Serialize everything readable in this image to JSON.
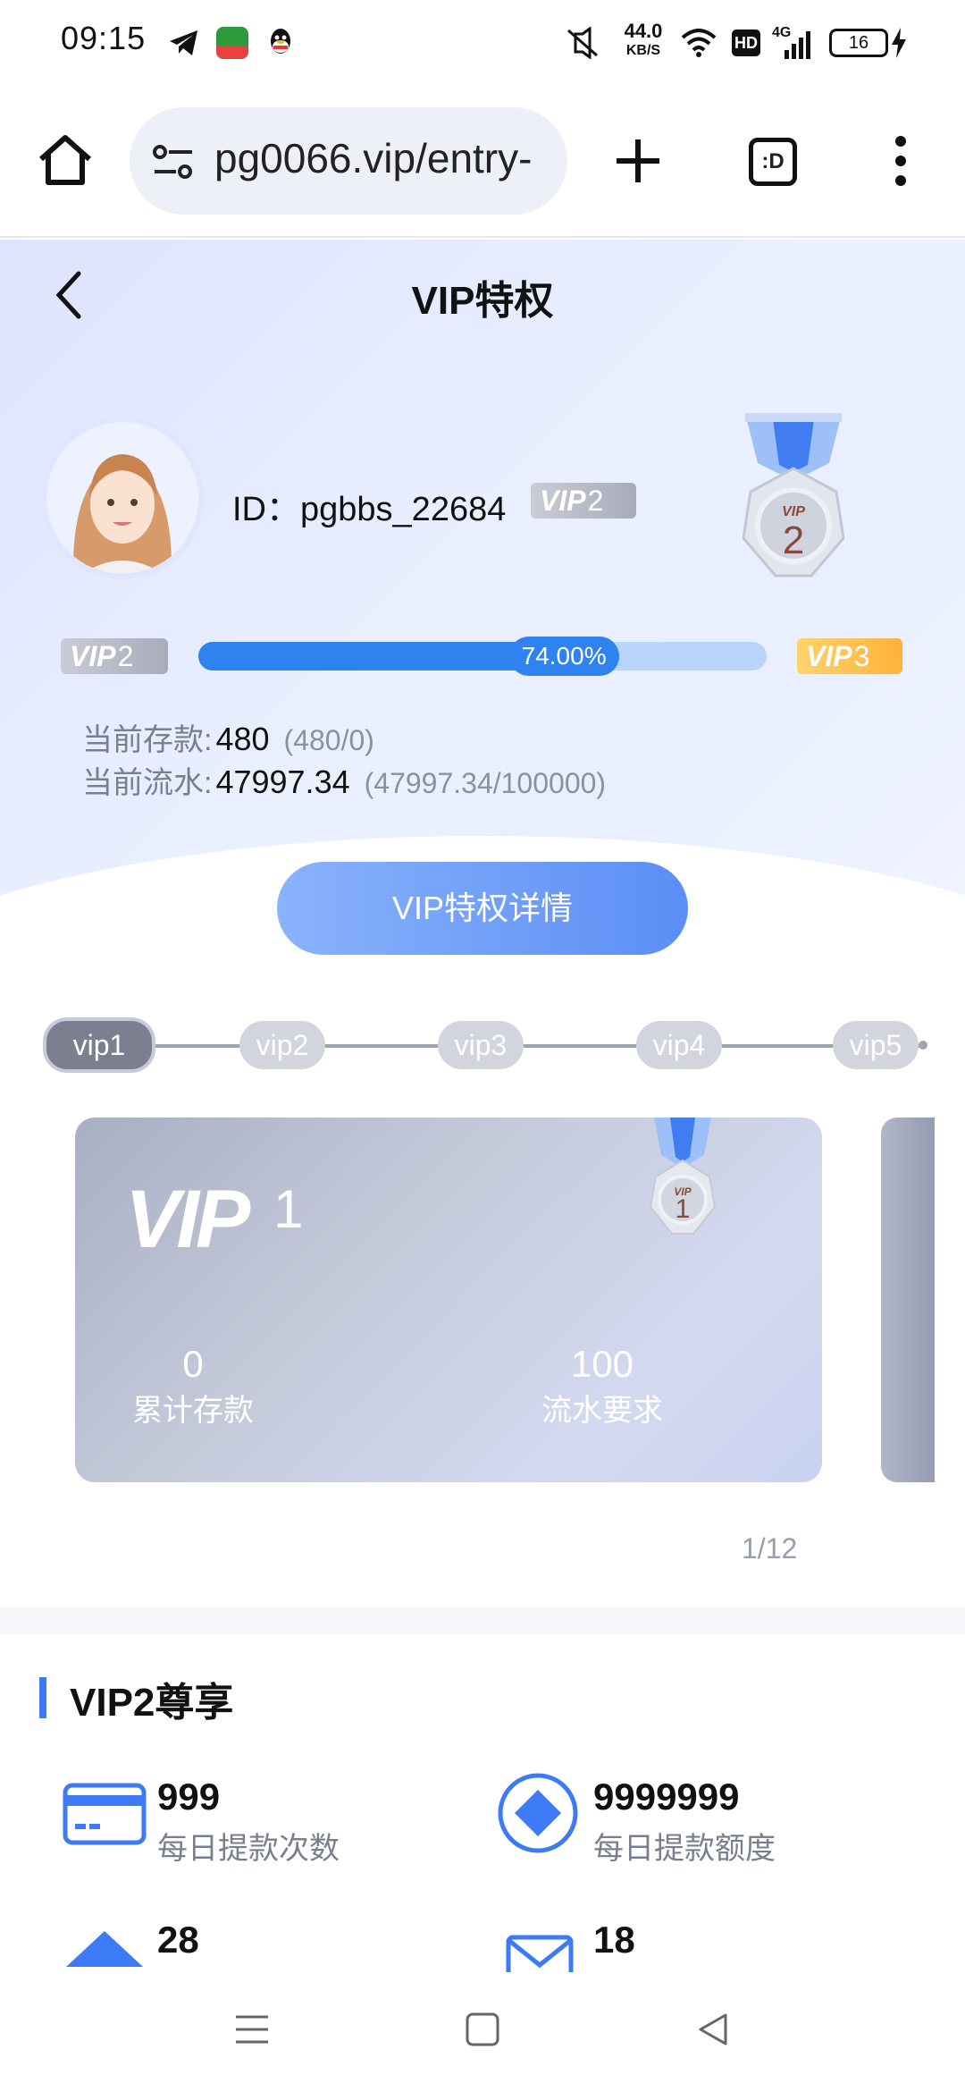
{
  "status_bar": {
    "time": "09:15",
    "net_speed_value": "44.0",
    "net_speed_unit": "KB/S",
    "hd_label": "HD",
    "signal_label": "4G",
    "battery": "16",
    "icons": [
      "telegram-icon",
      "oppo-app-icon",
      "qq-icon",
      "mute-icon",
      "wifi-icon",
      "signal-icon",
      "charging-icon"
    ]
  },
  "browser": {
    "url": "pg0066.vip/entry-",
    "tab_label": ":D",
    "icons": [
      "home-icon",
      "site-settings-icon",
      "new-tab-icon",
      "more-icon"
    ]
  },
  "header": {
    "title": "VIP特权"
  },
  "user": {
    "id_label": "ID：",
    "id": "pgbbs_22684",
    "vip_badge_text": "VIP",
    "vip_level": "2"
  },
  "progress": {
    "current_badge_text": "VIP",
    "current_level": "2",
    "next_badge_text": "VIP",
    "next_level": "3",
    "percent_label": "74.00%",
    "fraction": 0.74
  },
  "stats": {
    "deposit_label": "当前存款:",
    "deposit_value": "480",
    "deposit_detail": "(480/0)",
    "turnover_label": "当前流水:",
    "turnover_value": "47997.34",
    "turnover_detail": "(47997.34/100000)"
  },
  "detail_button": "VIP特权详情",
  "levels": [
    "vip1",
    "vip2",
    "vip3",
    "vip4",
    "vip5"
  ],
  "active_level": "vip1",
  "card": {
    "vip_text": "VIP",
    "level_num": "1",
    "medal_num": "1",
    "deposit_value": "0",
    "deposit_label": "累计存款",
    "turnover_value": "100",
    "turnover_label": "流水要求"
  },
  "pager": "1/12",
  "medal": {
    "vip_text": "VIP",
    "level_num": "2"
  },
  "perks_section": {
    "title": "VIP2尊享",
    "items": [
      {
        "value": "999",
        "label": "每日提款次数",
        "icon": "card-icon"
      },
      {
        "value": "9999999",
        "label": "每日提款额度",
        "icon": "diamond-icon"
      },
      {
        "value": "28",
        "label": "",
        "icon": "arrow-up-icon"
      },
      {
        "value": "18",
        "label": "",
        "icon": "envelope-icon"
      }
    ]
  },
  "nav_bar": {
    "icons": [
      "menu-icon",
      "home-square-icon",
      "back-triangle-icon"
    ]
  },
  "colors": {
    "accent": "#2e83f0",
    "gold": "#ffb23a",
    "grey_badge": "#a8acb9"
  }
}
